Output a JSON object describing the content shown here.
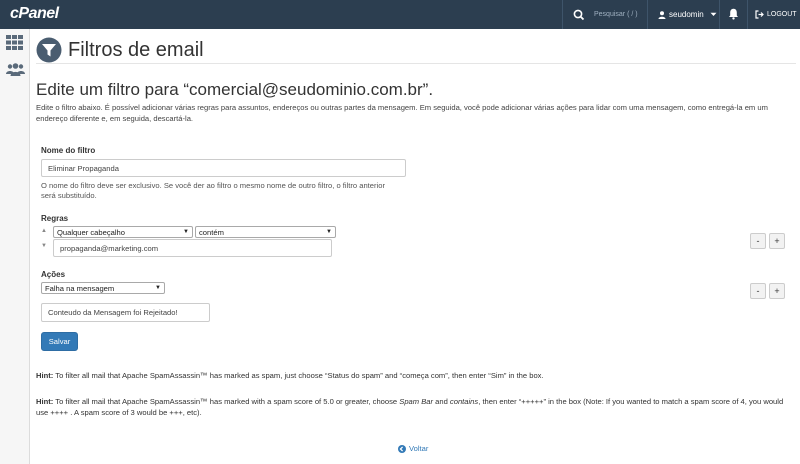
{
  "topbar": {
    "logo": "cPanel",
    "search_placeholder": "Pesquisar ( / )",
    "username": "seudomin",
    "logout_label": "LOGOUT"
  },
  "page": {
    "title": "Filtros de email",
    "subtitle": "Edite um filtro para “comercial@seudominio.com.br”.",
    "description": "Edite o filtro abaixo. É possível adicionar várias regras para assuntos, endereços ou outras partes da mensagem. Em seguida, você pode adicionar várias ações para lidar com uma mensagem, como entregá-la em um endereço diferente e, em seguida, descartá-la."
  },
  "form": {
    "filter_name_label": "Nome do filtro",
    "filter_name_value": "Eliminar Propaganda",
    "filter_name_help": "O nome do filtro deve ser exclusivo. Se você der ao filtro o mesmo nome de outro filtro, o filtro anterior será substituído.",
    "rules_label": "Regras",
    "rule_header_select": "Qualquer cabeçalho",
    "rule_operator_select": "contém",
    "rule_value": "propaganda@marketing.com",
    "actions_label": "Ações",
    "action_select": "Falha na mensagem",
    "action_value": "Conteudo da Mensagem foi Rejeitado!",
    "minus_label": "-",
    "plus_label": "+",
    "save_label": "Salvar"
  },
  "hints": {
    "hint1_label": "Hint:",
    "hint1_text": " To filter all mail that Apache SpamAssassin™ has marked as spam, just choose “Status do spam” and “começa com”, then enter “Sim” in the box.",
    "hint2_label": "Hint:",
    "hint2_text_a": " To filter all mail that Apache SpamAssassin™ has marked with a spam score of 5.0 or greater, choose ",
    "hint2_em1": "Spam Bar",
    "hint2_text_b": " and ",
    "hint2_em2": "contains",
    "hint2_text_c": ", then enter “+++++” in the box (Note: If you wanted to match a spam score of 4, you would use ++++ . A spam score of 3 would be +++, etc)."
  },
  "footer": {
    "back_label": "Voltar"
  },
  "colors": {
    "topbar": "#2c3e50",
    "primary": "#337ab7"
  }
}
